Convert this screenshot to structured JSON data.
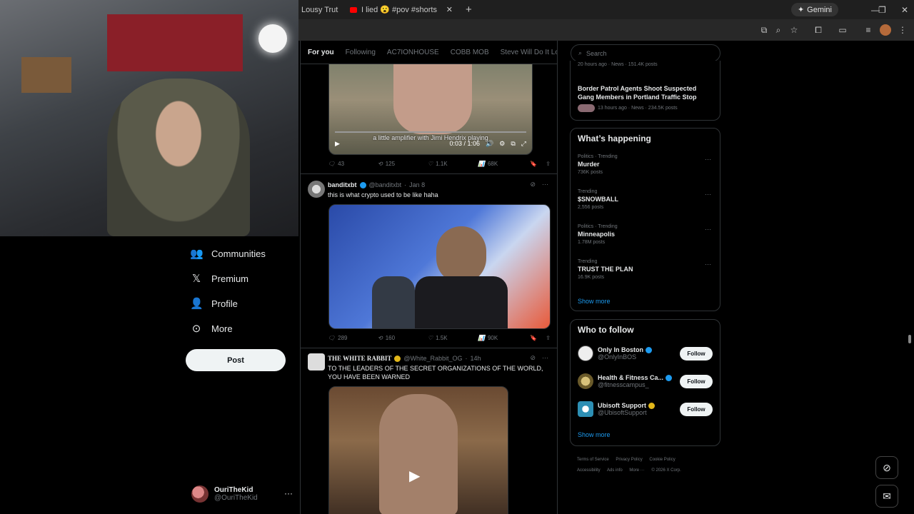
{
  "browser": {
    "tabs": [
      {
        "title": "Lousy Trut"
      },
      {
        "title": "I lied 😮 #pov #shorts #fyp #s"
      }
    ],
    "gemini_label": "Gemini"
  },
  "nav": {
    "items": [
      {
        "label": "Communities",
        "icon": "people-icon"
      },
      {
        "label": "Premium",
        "icon": "x-logo-icon"
      },
      {
        "label": "Profile",
        "icon": "person-icon"
      },
      {
        "label": "More",
        "icon": "more-circle-icon"
      }
    ],
    "post_label": "Post",
    "account": {
      "name": "OuriTheKid",
      "handle": "@OuriTheKid"
    }
  },
  "feed": {
    "tabs": [
      "For you",
      "Following",
      "AC7IONHOUSE",
      "COBB MOB",
      "Steve Will Do It Loyal"
    ],
    "tweet0": {
      "caption": "a little amplifier with Jimi Hendrix playing",
      "time": "0:03 / 1:06",
      "replies": "43",
      "reposts": "125",
      "likes": "1.1K",
      "views": "68K"
    },
    "tweet1": {
      "name": "banditxbt",
      "handle": "@banditxbt",
      "date": "Jan 8",
      "text": "this is what crypto used to be like haha",
      "replies": "289",
      "reposts": "160",
      "likes": "1.5K",
      "views": "90K"
    },
    "tweet2": {
      "name": "THE WHITE RABBIT",
      "handle": "@White_Rabbit_OG",
      "date": "14h",
      "text": "TO THE LEADERS OF THE SECRET ORGANIZATIONS OF THE WORLD, YOU HAVE BEEN WARNED"
    }
  },
  "right": {
    "search_placeholder": "Search",
    "news_top": {
      "meta": "20 hours ago · News · 151.4K posts"
    },
    "news": {
      "title": "Border Patrol Agents Shoot Suspected Gang Members in Portland Traffic Stop",
      "meta": "13 hours ago · News · 234.5K posts"
    },
    "happening": {
      "title": "What’s happening",
      "trends": [
        {
          "context": "Politics · Trending",
          "title": "Murder",
          "count": "736K posts"
        },
        {
          "context": "Trending",
          "title": "$SNOWBALL",
          "count": "2,556 posts"
        },
        {
          "context": "Politics · Trending",
          "title": "Minneapolis",
          "count": "1.78M posts"
        },
        {
          "context": "Trending",
          "title": "TRUST THE PLAN",
          "count": "16.9K posts"
        }
      ],
      "show_more": "Show more"
    },
    "who_to_follow": {
      "title": "Who to follow",
      "accounts": [
        {
          "name": "Only In Boston",
          "handle": "@OnlyInBOS",
          "follow": "Follow"
        },
        {
          "name": "Health & Fitness Ca...",
          "handle": "@fitnesscampus_",
          "follow": "Follow"
        },
        {
          "name": "Ubisoft Support",
          "handle": "@UbisoftSupport",
          "follow": "Follow"
        }
      ],
      "show_more": "Show more"
    },
    "footer": {
      "links": [
        "Terms of Service",
        "Privacy Policy",
        "Cookie Policy",
        "Accessibility",
        "Ads info",
        "More ···"
      ],
      "copyright": "© 2026 X Corp."
    }
  }
}
